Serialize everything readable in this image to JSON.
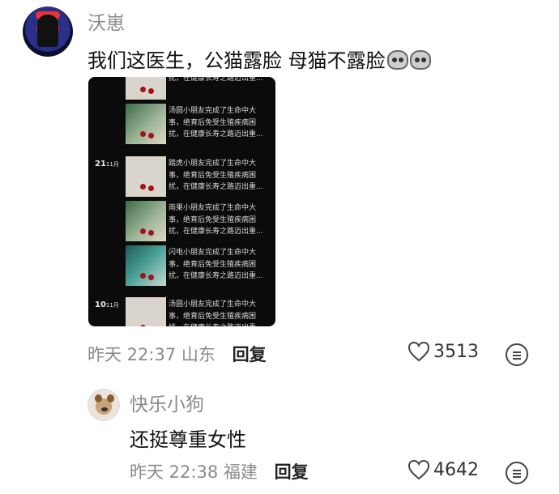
{
  "comment_main": {
    "username": "沃崽",
    "text": "我们这医生，公猫露脸 母猫不露脸",
    "emoji_icons": [
      "cat-face-icon",
      "cat-face-icon"
    ],
    "image": {
      "rows": [
        {
          "lines": [
            "",
            "扰，在健康长寿之路迈出重..."
          ],
          "date": "",
          "img": "plain"
        },
        {
          "lines": [
            "汤圆小朋友完成了生命中大",
            "事，绝育后免受生殖疾病困",
            "扰，在健康长寿之路迈出重..."
          ],
          "date": "",
          "img": "green"
        },
        {
          "lines": [
            "踏虎小朋友完成了生命中大",
            "事，绝育后免受生殖疾病困",
            "扰，在健康长寿之路迈出重..."
          ],
          "date": "21",
          "date_unit": "11月",
          "img": "plain"
        },
        {
          "lines": [
            "雨果小朋友完成了生命中大",
            "事，绝育后免受生殖疾病困",
            "扰，在健康长寿之路迈出重..."
          ],
          "date": "",
          "img": "green"
        },
        {
          "lines": [
            "闪电小朋友完成了生命中大",
            "事，绝育后免受生殖疾病困",
            "扰，在健康长寿之路迈出重..."
          ],
          "date": "",
          "img": "teal"
        },
        {
          "lines": [
            "汤圆小朋友完成了生命中大",
            "事，绝育后免受生殖疾病困",
            "扰，在健康长寿之路迈出重..."
          ],
          "date": "10",
          "date_unit": "11月",
          "img": "plain"
        }
      ]
    },
    "time": "昨天 22:37",
    "location": "山东",
    "reply_label": "回复",
    "likes": "3513"
  },
  "comment_reply": {
    "username": "快乐小狗",
    "text": "还挺尊重女性",
    "time": "昨天 22:38",
    "location": "福建",
    "reply_label": "回复",
    "likes": "4642"
  }
}
